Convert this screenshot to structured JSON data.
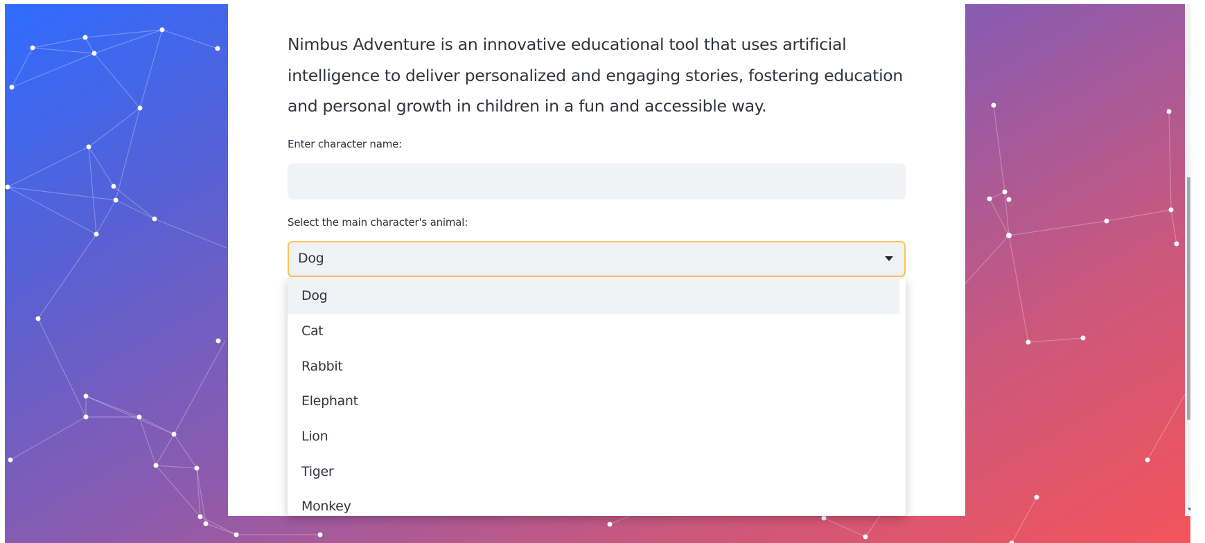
{
  "intro": {
    "text": "Nimbus Adventure is an innovative educational tool that uses artificial intelligence to deliver personalized and engaging stories, fostering education and personal growth in children in a fun and accessible way."
  },
  "character_name": {
    "label": "Enter character name:",
    "value": "",
    "placeholder": ""
  },
  "animal_select": {
    "label": "Select the main character's animal:",
    "selected": "Dog",
    "options": [
      "Dog",
      "Cat",
      "Rabbit",
      "Elephant",
      "Lion",
      "Tiger",
      "Monkey"
    ]
  },
  "colors": {
    "select_focus_border": "#f7c55a",
    "input_background": "#f0f2f6",
    "text": "#31333f",
    "gradient_start": "#2f6cff",
    "gradient_end": "#f4545a"
  },
  "icons": {
    "select_chevron": "chevron-down-icon",
    "scroll_down": "scroll-down-arrow-icon"
  }
}
